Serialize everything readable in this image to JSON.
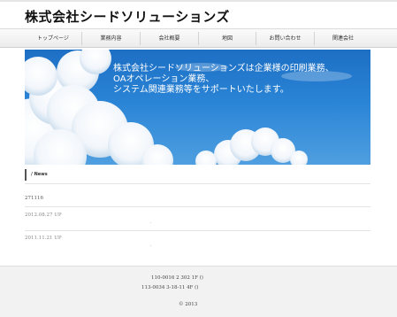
{
  "site": {
    "title": "株式会社シードソリューションズ"
  },
  "nav": {
    "items": [
      {
        "label": "トップページ"
      },
      {
        "label": "業務内容"
      },
      {
        "label": "会社概要"
      },
      {
        "label": "地図"
      },
      {
        "label": "お問い合わせ"
      },
      {
        "label": "関連会社"
      }
    ]
  },
  "hero": {
    "lines": [
      "株式会社シードソリューションズは企業様の印刷業務、",
      "OAオペレーション業務、",
      "システム関連業務等をサポートいたします。"
    ]
  },
  "news": {
    "heading": "/ News",
    "items": [
      {
        "text": "271116"
      },
      {
        "date": "2012.08.27 UP",
        "dot": "."
      },
      {
        "date": "2011.11.21 UP",
        "dot": "."
      }
    ]
  },
  "footer": {
    "address1": "110-0016 2 302 1F ()",
    "address2": "113-0034 3-18-11 4F ()",
    "copyright": "© 2013"
  }
}
